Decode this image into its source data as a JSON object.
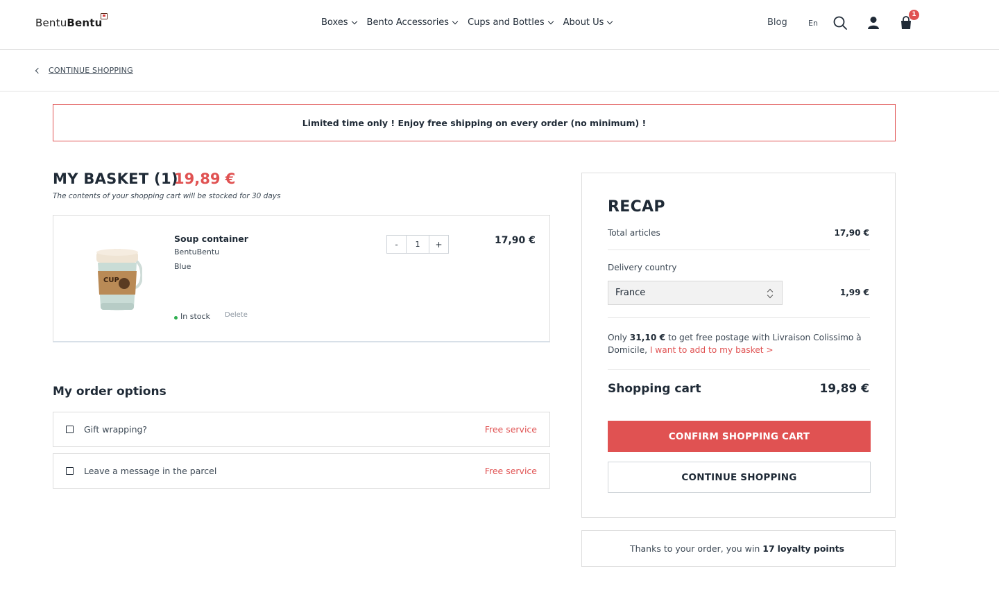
{
  "header": {
    "logo_light": "Bentu",
    "logo_bold": "Bentu",
    "nav": [
      "Boxes",
      "Bento Accessories",
      "Cups and Bottles",
      "About Us"
    ],
    "blog": "Blog",
    "language": "En",
    "cart_count": "1"
  },
  "breadcrumb": {
    "back_label": "CONTINUE SHOPPING"
  },
  "promo": {
    "text": "Limited time only ! Enjoy free shipping on every order  (no minimum) !"
  },
  "basket": {
    "title": "MY BASKET (1)",
    "total": "19,89 €",
    "note": "The contents of your shopping cart will be stocked for 30 days",
    "item": {
      "name": "Soup container",
      "brand": "BentuBentu",
      "color": "Blue",
      "stock": "In stock",
      "delete": "Delete",
      "qty_minus": "-",
      "quantity": "1",
      "qty_plus": "+",
      "price": "17,90 €",
      "image_label": "CUP"
    }
  },
  "options": {
    "title": "My order options",
    "items": [
      {
        "label": "Gift wrapping?",
        "price": "Free service"
      },
      {
        "label": "Leave a message in the parcel",
        "price": "Free service"
      }
    ]
  },
  "recap": {
    "title": "RECAP",
    "total_articles_label": "Total articles",
    "total_articles_value": "17,90 €",
    "delivery_label": "Delivery country",
    "country": "France",
    "delivery_value": "1,99 €",
    "free_prefix": "Only ",
    "free_amount": "31,10 €",
    "free_middle": " to get free postage with Livraison Colissimo à Domicile, ",
    "free_link": "I want to add to my basket >",
    "cart_label": "Shopping cart",
    "cart_value": "19,89 €",
    "confirm": "CONFIRM SHOPPING CART",
    "continue": "CONTINUE SHOPPING"
  },
  "loyalty": {
    "prefix": "Thanks to your order, you win",
    "points": "17",
    "suffix": "loyalty points"
  },
  "colors": {
    "accent": "#e05252",
    "text": "#1f2a36",
    "stock": "#2eae4f"
  }
}
